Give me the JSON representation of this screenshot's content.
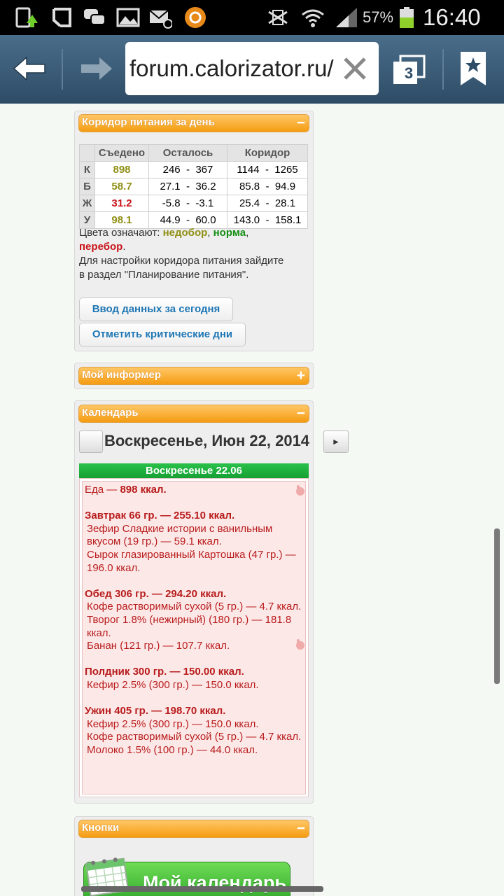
{
  "status_bar": {
    "battery_percent": "57%",
    "time": "16:40"
  },
  "browser": {
    "url": "forum.calorizator.ru/",
    "tab_count": "3"
  },
  "corridor": {
    "title": "Коридор питания за день",
    "toggle": "−",
    "columns": [
      "Съедено",
      "Осталось",
      "Коридор"
    ],
    "rows": [
      {
        "label": "К",
        "eaten": "898",
        "rem_min": "246",
        "rem_max": "367",
        "cor_min": "1144",
        "cor_max": "1265",
        "status": "under"
      },
      {
        "label": "Б",
        "eaten": "58.7",
        "rem_min": "27.1",
        "rem_max": "36.2",
        "cor_min": "85.8",
        "cor_max": "94.9",
        "status": "under"
      },
      {
        "label": "Ж",
        "eaten": "31.2",
        "rem_min": "-5.8",
        "rem_max": "-3.1",
        "cor_min": "25.4",
        "cor_max": "28.1",
        "status": "over"
      },
      {
        "label": "У",
        "eaten": "98.1",
        "rem_min": "44.9",
        "rem_max": "60.0",
        "cor_min": "143.0",
        "cor_max": "158.1",
        "status": "under"
      }
    ],
    "dash": "-",
    "legend_prefix": "Цвета означают:",
    "legend_under": "недобор",
    "legend_norm": "норма",
    "legend_over": "перебор",
    "comma": ",",
    "period": ".",
    "settings_note": "Для настройки коридора питания зайдите в раздел \"Планирование питания\".",
    "button_today": "Ввод данных за сегодня",
    "button_critical": "Отметить критические дни"
  },
  "informer": {
    "title": "Мой информер",
    "toggle": "+"
  },
  "calendar": {
    "title": "Календарь",
    "toggle": "−",
    "date": "Воскресенье, Июн 22, 2014",
    "next_glyph": "►",
    "day_header": "Воскресенье 22.06",
    "food_label": "Еда —",
    "food_total": "898 ккал.",
    "meals": [
      {
        "header": "Завтрак 66 гр. — 255.10 ккал.",
        "items": [
          "Зефир Сладкие истории с ванильным вкусом (19 гр.) — 59.1 ккал.",
          "Сырок глазированный Картошка (47 гр.) — 196.0 ккал."
        ]
      },
      {
        "header": "Обед 306 гр. — 294.20 ккал.",
        "items": [
          "Кофе растворимый сухой (5 гр.) — 4.7 ккал.",
          "Творог 1.8% (нежирный) (180 гр.) — 181.8 ккал.",
          "Банан (121 гр.) — 107.7 ккал."
        ]
      },
      {
        "header": "Полдник 300 гр. — 150.00 ккал.",
        "items": [
          "Кефир 2.5% (300 гр.) — 150.0 ккал."
        ]
      },
      {
        "header": "Ужин 405 гр. — 198.70 ккал.",
        "items": [
          "Кефир 2.5% (300 гр.) — 150.0 ккал.",
          "Кофе растворимый сухой (5 гр.) — 4.7 ккал.",
          "Молоко 1.5% (100 гр.) — 44.0 ккал."
        ]
      }
    ]
  },
  "buttons_panel": {
    "title": "Кнопки",
    "toggle": "−",
    "my_calendar": "Мой календарь"
  }
}
